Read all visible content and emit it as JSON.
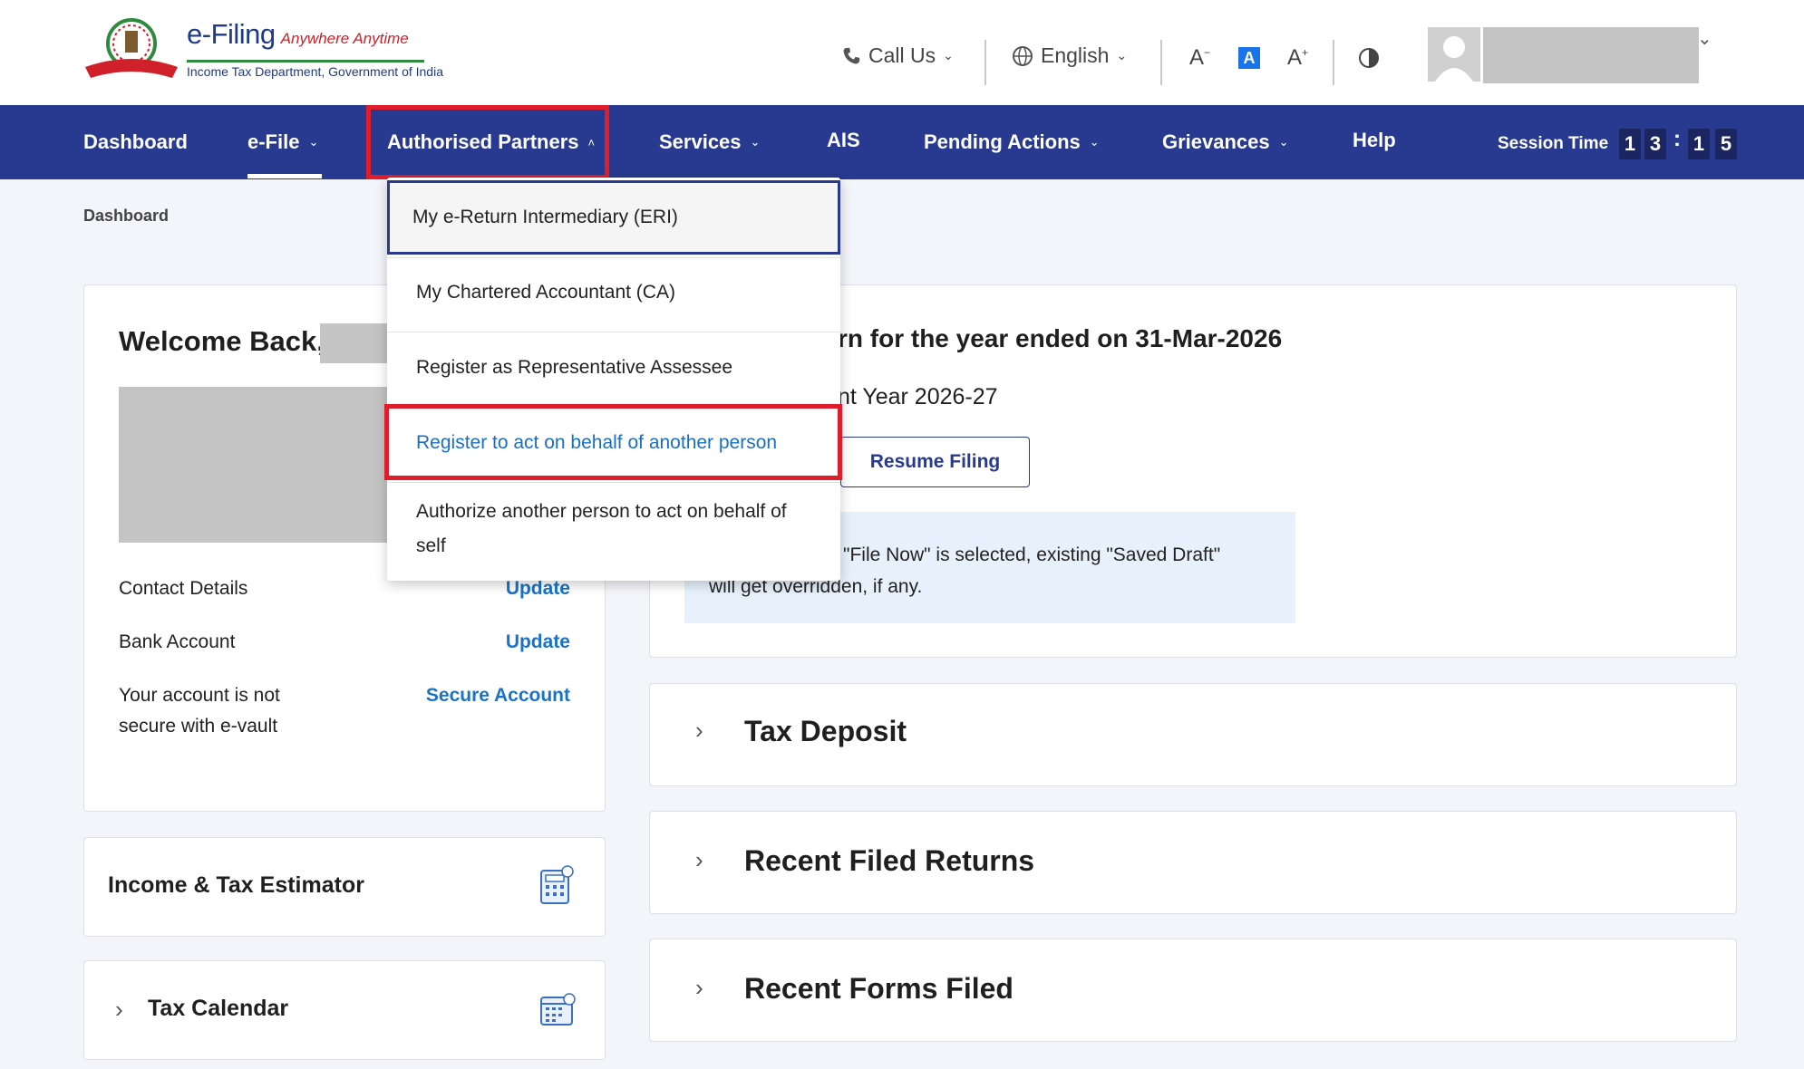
{
  "header": {
    "brand_name": "e-Filing",
    "brand_tagline": "Anywhere Anytime",
    "brand_subtitle": "Income Tax Department, Government of India",
    "call_us": "Call Us",
    "language": "English"
  },
  "nav": {
    "items": [
      "Dashboard",
      "e-File",
      "Authorised Partners",
      "Services",
      "AIS",
      "Pending Actions",
      "Grievances",
      "Help"
    ],
    "session_label": "Session Time",
    "session_digits": [
      "1",
      "3",
      "1",
      "5"
    ]
  },
  "breadcrumb": "Dashboard",
  "dropdown": {
    "items": [
      "My e-Return Intermediary (ERI)",
      "My Chartered Accountant (CA)",
      "Register as Representative Assessee",
      "Register to act on behalf of another person",
      "Authorize another person to act on behalf of self"
    ]
  },
  "profile_card": {
    "welcome": "Welcome Back,",
    "rows": [
      {
        "label": "Contact Details",
        "action": "Update"
      },
      {
        "label": "Bank Account",
        "action": "Update"
      },
      {
        "label": "Your account is not secure with e-vault",
        "action": "Secure Account"
      }
    ]
  },
  "itr_card": {
    "title_fragment": "rn for the year ended on 31-Mar-2026",
    "sub_fragment": "nt Year 2026-27",
    "resume_button": "Resume Filing",
    "info_line1": "\"File Now\" is selected, existing \"Saved Draft\"",
    "info_line2": "will get overridden, if any."
  },
  "accordions": [
    "Tax Deposit",
    "Recent Filed Returns",
    "Recent Forms Filed"
  ],
  "side_cards": {
    "estimator": "Income & Tax Estimator",
    "calendar": "Tax Calendar"
  },
  "colors": {
    "nav_bg": "#283a8f",
    "highlight_red": "#e01e2b",
    "link_blue": "#1a73c8"
  }
}
